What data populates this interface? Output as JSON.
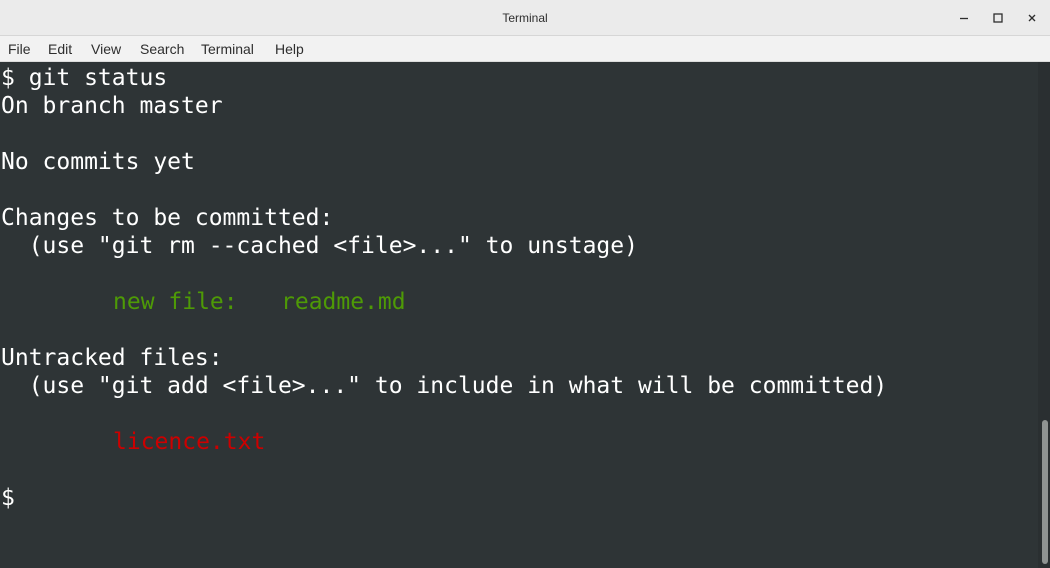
{
  "window": {
    "title": "Terminal",
    "controls": [
      "minimize-icon",
      "maximize-icon",
      "close-icon"
    ]
  },
  "menubar": {
    "items": [
      "File",
      "Edit",
      "View",
      "Search",
      "Terminal",
      "Help"
    ]
  },
  "terminal": {
    "colors": {
      "background": "#2e3436",
      "foreground": "#ffffff",
      "staged": "#4e9a06",
      "untracked": "#cc0000"
    },
    "lines": {
      "command": "$ git status",
      "branch": "On branch master",
      "no_commits": "No commits yet",
      "changes_header": "Changes to be committed:",
      "changes_hint": "  (use \"git rm --cached <file>...\" to unstage)",
      "new_file_label": "new file:",
      "new_file_name": "readme.md",
      "untracked_header": "Untracked files:",
      "untracked_hint": "  (use \"git add <file>...\" to include in what will be committed)",
      "untracked_file": "licence.txt",
      "prompt": "$"
    }
  }
}
